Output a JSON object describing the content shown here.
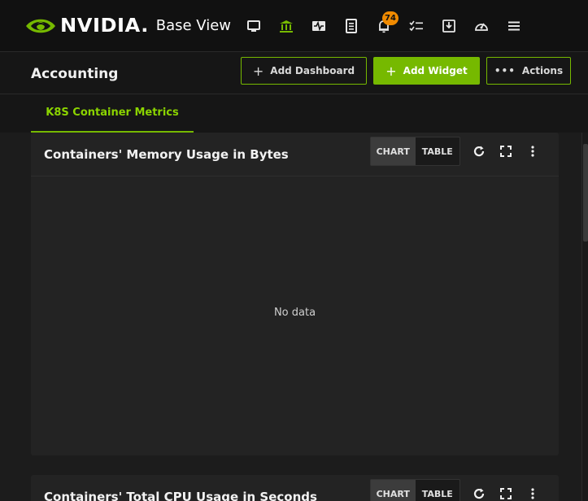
{
  "brand": {
    "wordmark": "NVIDIA.",
    "product": "Base View",
    "accent_color": "#76b900"
  },
  "nav": {
    "icons": [
      {
        "name": "monitor-icon"
      },
      {
        "name": "bank-icon",
        "active": true
      },
      {
        "name": "pulse-icon"
      },
      {
        "name": "document-icon"
      },
      {
        "name": "bell-icon"
      },
      {
        "name": "checklist-icon"
      },
      {
        "name": "download-icon"
      },
      {
        "name": "dashboard-gauge-icon"
      },
      {
        "name": "hamburger-menu-icon"
      }
    ],
    "notifications_count": "74",
    "badge_color": "#f08a00"
  },
  "header": {
    "title": "Accounting",
    "add_dashboard_label": "Add Dashboard",
    "add_widget_label": "Add Widget",
    "actions_label": "Actions"
  },
  "tabs": [
    {
      "label": "K8S Container Metrics",
      "active": true
    }
  ],
  "widgets": [
    {
      "title": "Containers' Memory Usage in Bytes",
      "view_chart_label": "CHART",
      "view_table_label": "TABLE",
      "active_view": "CHART",
      "empty_message": "No data"
    },
    {
      "title": "Containers' Total CPU Usage in Seconds",
      "view_chart_label": "CHART",
      "view_table_label": "TABLE",
      "active_view": "CHART"
    }
  ]
}
